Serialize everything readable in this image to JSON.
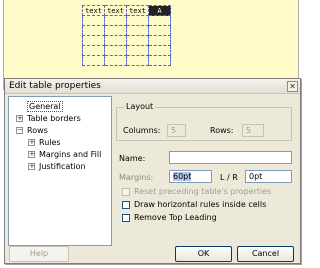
{
  "document": {
    "table_rows": [
      [
        "text",
        "text",
        "text",
        "A"
      ],
      [
        "",
        "",
        "",
        ""
      ],
      [
        "",
        "",
        "",
        ""
      ],
      [
        "",
        "",
        "",
        ""
      ],
      [
        "",
        "",
        "",
        ""
      ],
      [
        "",
        "",
        "",
        ""
      ]
    ]
  },
  "dialog": {
    "title": "Edit table properties",
    "close_glyph": "✕",
    "tree": [
      {
        "label": "General",
        "level": 0,
        "expander": "",
        "selected": true
      },
      {
        "label": "Table borders",
        "level": 0,
        "expander": "+"
      },
      {
        "label": "Rows",
        "level": 0,
        "expander": "−"
      },
      {
        "label": "Rules",
        "level": 1,
        "expander": "+"
      },
      {
        "label": "Margins and Fill",
        "level": 1,
        "expander": "+"
      },
      {
        "label": "Justification",
        "level": 1,
        "expander": "+"
      }
    ],
    "layout": {
      "title": "Layout",
      "columns_label": "Columns:",
      "columns_value": "5",
      "rows_label": "Rows:",
      "rows_value": "5"
    },
    "name_label": "Name:",
    "name_value": "",
    "margins_label": "Margins:",
    "margins_value": "60pt",
    "lr_label": "L / R",
    "lr_value": "0pt",
    "checkboxes": [
      {
        "label": "Reset preceding table's properties",
        "checked": false,
        "enabled": false
      },
      {
        "label": "Draw horizontal rules inside cells",
        "checked": false,
        "enabled": true
      },
      {
        "label": "Remove Top Leading",
        "checked": false,
        "enabled": true
      }
    ],
    "buttons": {
      "help": "Help",
      "ok": "OK",
      "cancel": "Cancel"
    }
  }
}
